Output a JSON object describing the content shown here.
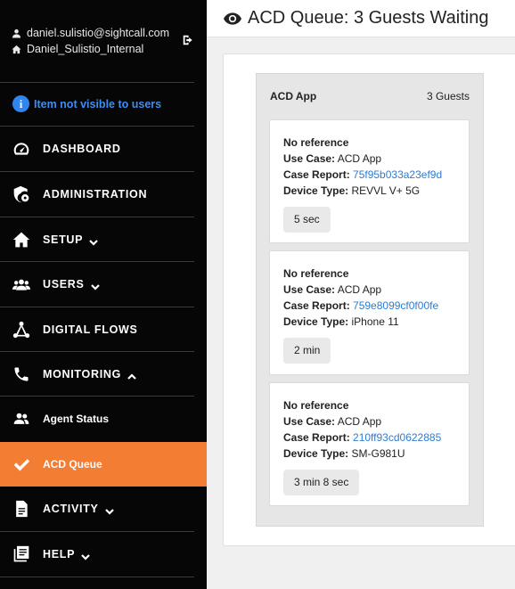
{
  "user": {
    "email": "daniel.sulistio@sightcall.com",
    "org": "Daniel_Sulistio_Internal"
  },
  "notice": "Item not visible to users",
  "nav": {
    "dashboard": "DASHBOARD",
    "administration": "ADMINISTRATION",
    "setup": "SETUP",
    "users": "USERS",
    "digital_flows": "DIGITAL FLOWS",
    "monitoring": "MONITORING",
    "agent_status": "Agent Status",
    "acd_queue": "ACD Queue",
    "activity": "ACTIVITY",
    "help": "HELP"
  },
  "header": {
    "title": "ACD Queue: 3 Guests Waiting"
  },
  "queue": {
    "name": "ACD App",
    "count": "3 Guests",
    "guests": [
      {
        "reference": "No reference",
        "use_case_label": "Use Case:",
        "use_case": "ACD App",
        "case_report_label": "Case Report:",
        "case_report": "75f95b033a23ef9d",
        "device_type_label": "Device Type:",
        "device_type": "REVVL V+ 5G",
        "wait": "5 sec"
      },
      {
        "reference": "No reference",
        "use_case_label": "Use Case:",
        "use_case": "ACD App",
        "case_report_label": "Case Report:",
        "case_report": "759e8099cf0f00fe",
        "device_type_label": "Device Type:",
        "device_type": "iPhone 11",
        "wait": "2 min"
      },
      {
        "reference": "No reference",
        "use_case_label": "Use Case:",
        "use_case": "ACD App",
        "case_report_label": "Case Report:",
        "case_report": "210ff93cd0622885",
        "device_type_label": "Device Type:",
        "device_type": "SM-G981U",
        "wait": "3 min 8 sec"
      }
    ]
  },
  "colors": {
    "sidebar_bg": "#060606",
    "active": "#f37d33",
    "link": "#2f7bd0",
    "notice": "#3d8ef0"
  }
}
